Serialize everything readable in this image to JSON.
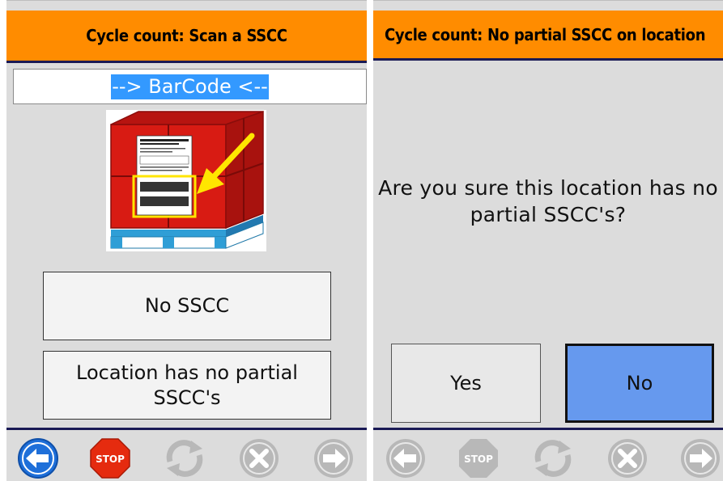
{
  "left_screen": {
    "title": "Cycle count: Scan a SSCC",
    "barcode_input": {
      "value": "--> BarCode <--"
    },
    "image": {
      "label_company": "THE COMPANY LIMITED",
      "description": "pallet-with-sscc-label-image"
    },
    "buttons": {
      "no_sscc": "No SSCC",
      "no_partial": "Location has no partial SSCC's"
    },
    "nav_icons": [
      {
        "name": "back-arrow-icon",
        "state": "enabled",
        "color": "#1e6fd9"
      },
      {
        "name": "stop-icon",
        "state": "enabled",
        "color": "#e52b0f",
        "label": "STOP"
      },
      {
        "name": "refresh-icon",
        "state": "disabled"
      },
      {
        "name": "cancel-x-icon",
        "state": "disabled"
      },
      {
        "name": "forward-arrow-icon",
        "state": "disabled"
      }
    ]
  },
  "right_screen": {
    "title": "Cycle count: No partial SSCC on location",
    "question": "Are you sure this location has no partial SSCC's?",
    "buttons": {
      "yes": "Yes",
      "no": "No"
    },
    "nav_icons": [
      {
        "name": "back-arrow-icon",
        "state": "disabled"
      },
      {
        "name": "stop-icon",
        "state": "disabled",
        "label": "STOP"
      },
      {
        "name": "refresh-icon",
        "state": "disabled"
      },
      {
        "name": "cancel-x-icon",
        "state": "disabled"
      },
      {
        "name": "forward-arrow-icon",
        "state": "disabled"
      }
    ]
  },
  "colors": {
    "header": "#ff8c00",
    "selected_button": "#6699ee",
    "selection": "#3399ff"
  }
}
